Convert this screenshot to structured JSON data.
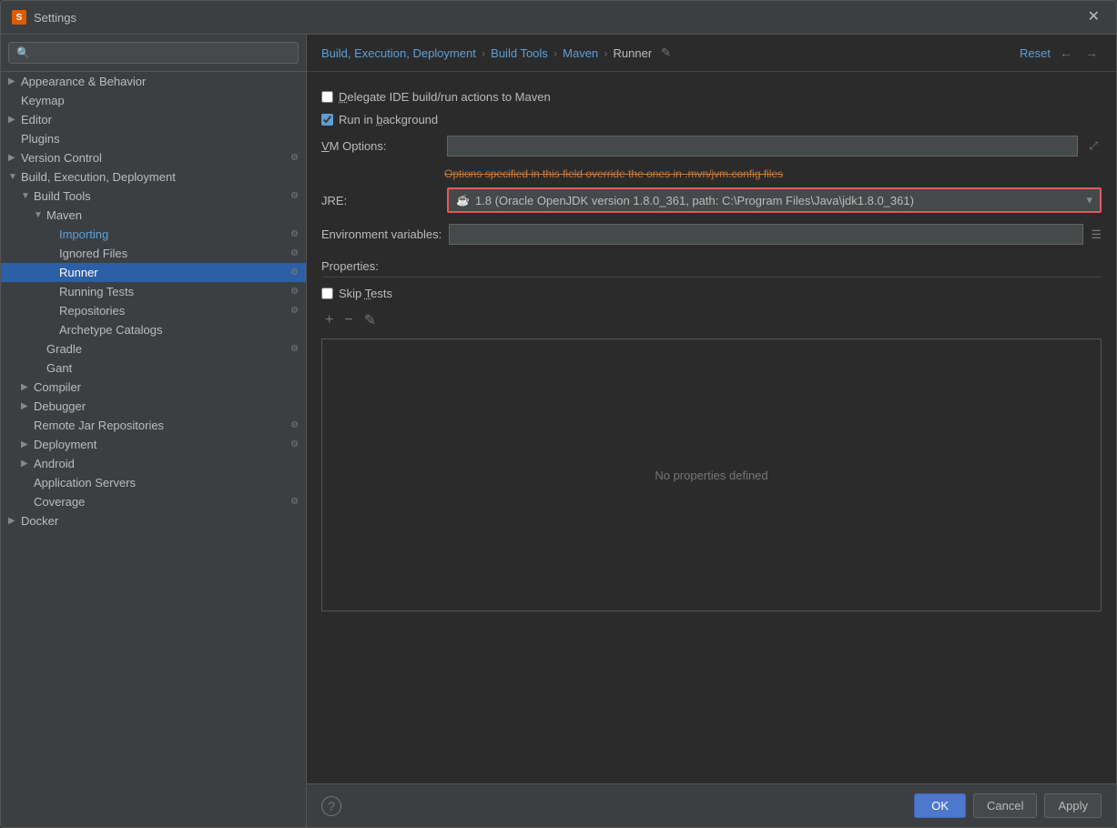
{
  "window": {
    "title": "Settings",
    "icon": "S"
  },
  "breadcrumb": {
    "items": [
      {
        "label": "Build, Execution, Deployment",
        "type": "link"
      },
      {
        "label": "›",
        "type": "sep"
      },
      {
        "label": "Build Tools",
        "type": "link"
      },
      {
        "label": "›",
        "type": "sep"
      },
      {
        "label": "Maven",
        "type": "link"
      },
      {
        "label": "›",
        "type": "sep"
      },
      {
        "label": "Runner",
        "type": "active"
      }
    ],
    "reset_label": "Reset",
    "edit_icon": "✎"
  },
  "sidebar": {
    "search_placeholder": "🔍",
    "items": [
      {
        "level": 0,
        "arrow": "▶",
        "label": "Appearance & Behavior",
        "selected": false,
        "has_gear": false
      },
      {
        "level": 0,
        "arrow": "",
        "label": "Keymap",
        "selected": false,
        "has_gear": false
      },
      {
        "level": 0,
        "arrow": "▶",
        "label": "Editor",
        "selected": false,
        "has_gear": false
      },
      {
        "level": 0,
        "arrow": "",
        "label": "Plugins",
        "selected": false,
        "has_gear": false
      },
      {
        "level": 0,
        "arrow": "▶",
        "label": "Version Control",
        "selected": false,
        "has_gear": true
      },
      {
        "level": 0,
        "arrow": "▼",
        "label": "Build, Execution, Deployment",
        "selected": false,
        "has_gear": false
      },
      {
        "level": 1,
        "arrow": "▼",
        "label": "Build Tools",
        "selected": false,
        "has_gear": true
      },
      {
        "level": 2,
        "arrow": "▼",
        "label": "Maven",
        "selected": false,
        "has_gear": false
      },
      {
        "level": 3,
        "arrow": "",
        "label": "Importing",
        "selected": false,
        "has_gear": true,
        "active": true
      },
      {
        "level": 3,
        "arrow": "",
        "label": "Ignored Files",
        "selected": false,
        "has_gear": true
      },
      {
        "level": 3,
        "arrow": "",
        "label": "Runner",
        "selected": true,
        "has_gear": true
      },
      {
        "level": 3,
        "arrow": "",
        "label": "Running Tests",
        "selected": false,
        "has_gear": true
      },
      {
        "level": 3,
        "arrow": "",
        "label": "Repositories",
        "selected": false,
        "has_gear": true
      },
      {
        "level": 3,
        "arrow": "",
        "label": "Archetype Catalogs",
        "selected": false,
        "has_gear": false
      },
      {
        "level": 2,
        "arrow": "",
        "label": "Gradle",
        "selected": false,
        "has_gear": true
      },
      {
        "level": 2,
        "arrow": "",
        "label": "Gant",
        "selected": false,
        "has_gear": false
      },
      {
        "level": 1,
        "arrow": "▶",
        "label": "Compiler",
        "selected": false,
        "has_gear": false
      },
      {
        "level": 1,
        "arrow": "▶",
        "label": "Debugger",
        "selected": false,
        "has_gear": false
      },
      {
        "level": 1,
        "arrow": "",
        "label": "Remote Jar Repositories",
        "selected": false,
        "has_gear": true
      },
      {
        "level": 1,
        "arrow": "▶",
        "label": "Deployment",
        "selected": false,
        "has_gear": true
      },
      {
        "level": 1,
        "arrow": "▶",
        "label": "Android",
        "selected": false,
        "has_gear": false
      },
      {
        "level": 1,
        "arrow": "",
        "label": "Application Servers",
        "selected": false,
        "has_gear": false
      },
      {
        "level": 1,
        "arrow": "",
        "label": "Coverage",
        "selected": false,
        "has_gear": true
      },
      {
        "level": 0,
        "arrow": "▶",
        "label": "Docker",
        "selected": false,
        "has_gear": false
      }
    ]
  },
  "runner": {
    "delegate_checkbox": {
      "label": "Delegate IDE build/run actions to Maven",
      "checked": false
    },
    "background_checkbox": {
      "label": "Run in background",
      "checked": true
    },
    "vm_options": {
      "label": "VM Options:",
      "value": "",
      "placeholder": ""
    },
    "hint": "Options specified in this field override the ones in .mvn/jvm.config files",
    "jre": {
      "label": "JRE:",
      "value": "1.8 (Oracle OpenJDK version 1.8.0_361, path: C:\\Program Files\\Java\\jdk1.8.0_361)"
    },
    "env_vars": {
      "label": "Environment variables:",
      "value": ""
    },
    "properties": {
      "section_label": "Properties:",
      "skip_tests": {
        "label": "Skip Tests",
        "checked": false
      },
      "no_props_text": "No properties defined",
      "toolbar": {
        "add": "+",
        "remove": "−",
        "edit": "✎"
      }
    }
  },
  "footer": {
    "ok": "OK",
    "cancel": "Cancel",
    "apply": "Apply",
    "help": "?"
  }
}
